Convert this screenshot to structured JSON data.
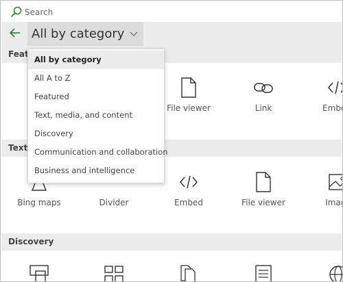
{
  "search": {
    "placeholder": "Search",
    "icon": "search-icon"
  },
  "header": {
    "back_icon": "back-arrow-icon",
    "selected_category": "All by category",
    "chevron_icon": "chevron-down-icon"
  },
  "dropdown": {
    "items": [
      {
        "label": "All by category",
        "selected": true
      },
      {
        "label": "All A to Z",
        "selected": false
      },
      {
        "label": "Featured",
        "selected": false
      },
      {
        "label": "Text, media, and content",
        "selected": false
      },
      {
        "label": "Discovery",
        "selected": false
      },
      {
        "label": "Communication and collaboration",
        "selected": false
      },
      {
        "label": "Business and intelligence",
        "selected": false
      }
    ]
  },
  "sections": {
    "featured": {
      "title": "Featured",
      "tiles": [
        {
          "label": "File viewer",
          "icon": "document-icon"
        },
        {
          "label": "Link",
          "icon": "link-icon"
        },
        {
          "label": "Embed",
          "icon": "embed-code-icon"
        }
      ]
    },
    "text_media": {
      "title": "Text, media, and content",
      "tiles": [
        {
          "label": "Bing maps",
          "icon": "map-pin-icon"
        },
        {
          "label": "Divider",
          "icon": "divider-icon"
        },
        {
          "label": "Embed",
          "icon": "embed-code-icon"
        },
        {
          "label": "File viewer",
          "icon": "document-icon"
        },
        {
          "label": "Image",
          "icon": "image-icon"
        }
      ]
    },
    "discovery": {
      "title": "Discovery",
      "tiles": [
        {
          "icon": "highlighted-content-icon"
        },
        {
          "icon": "tiles-grid-icon"
        },
        {
          "icon": "documents-stack-icon"
        },
        {
          "icon": "list-document-icon"
        },
        {
          "icon": "globe-icon"
        }
      ]
    }
  },
  "colors": {
    "accent": "#2e7d32",
    "header_bg": "#ececec",
    "select_bg": "#dcdcdc"
  }
}
